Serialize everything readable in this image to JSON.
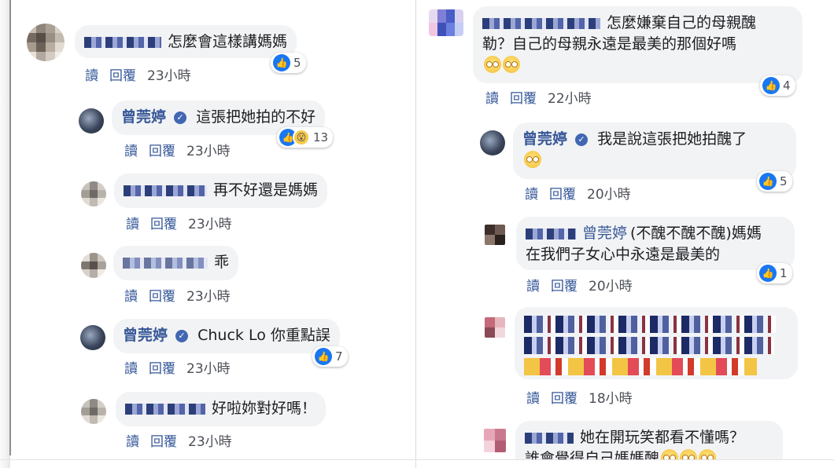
{
  "meta_labels": {
    "read": "讀",
    "reply": "回覆"
  },
  "left_column": {
    "comments": [
      {
        "id": "c1",
        "text": "怎麼會這樣講媽媽",
        "time": "23小時",
        "reactions": "5"
      },
      {
        "id": "c2",
        "author": "曾莞婷",
        "text": "這張把她拍的不好",
        "time": "23小時",
        "reactions": "13"
      },
      {
        "id": "c3",
        "text": "再不好還是媽媽",
        "time": "23小時"
      },
      {
        "id": "c4",
        "text": "乖",
        "time": "23小時"
      },
      {
        "id": "c5",
        "author": "曾莞婷",
        "text": "Chuck Lo 你重點誤",
        "time": "23小時",
        "reactions": "7"
      },
      {
        "id": "c6",
        "text": "好啦妳對好嗎！",
        "time": "23小時"
      }
    ]
  },
  "right_column": {
    "comments": [
      {
        "id": "r1",
        "line1": "怎麼嫌棄自己的母親醜",
        "line2": "勒？自己的母親永遠是最美的那個好嗎",
        "time": "22小時",
        "reactions": "4"
      },
      {
        "id": "r2",
        "author": "曾莞婷",
        "text": "我是說這張把她拍醜了",
        "time": "20小時",
        "reactions": "5"
      },
      {
        "id": "r3",
        "mention": "曾莞婷",
        "line1": "(不醜不醜不醜)媽媽",
        "line2": "在我們子女心中永遠是最美的",
        "time": "20小時",
        "reactions": "1"
      },
      {
        "id": "r4",
        "time": "18小時"
      },
      {
        "id": "r5",
        "line1": "她在開玩笑都看不懂嗎？",
        "line2": "誰會覺得自己媽媽醜"
      }
    ]
  },
  "colors": {
    "name": "#385898",
    "bubble": "#f2f3f5",
    "like": "#1877f2",
    "meta": "#365899"
  },
  "icons": [
    "like-icon",
    "wow-icon",
    "verified-badge-icon",
    "emoji-icon"
  ]
}
